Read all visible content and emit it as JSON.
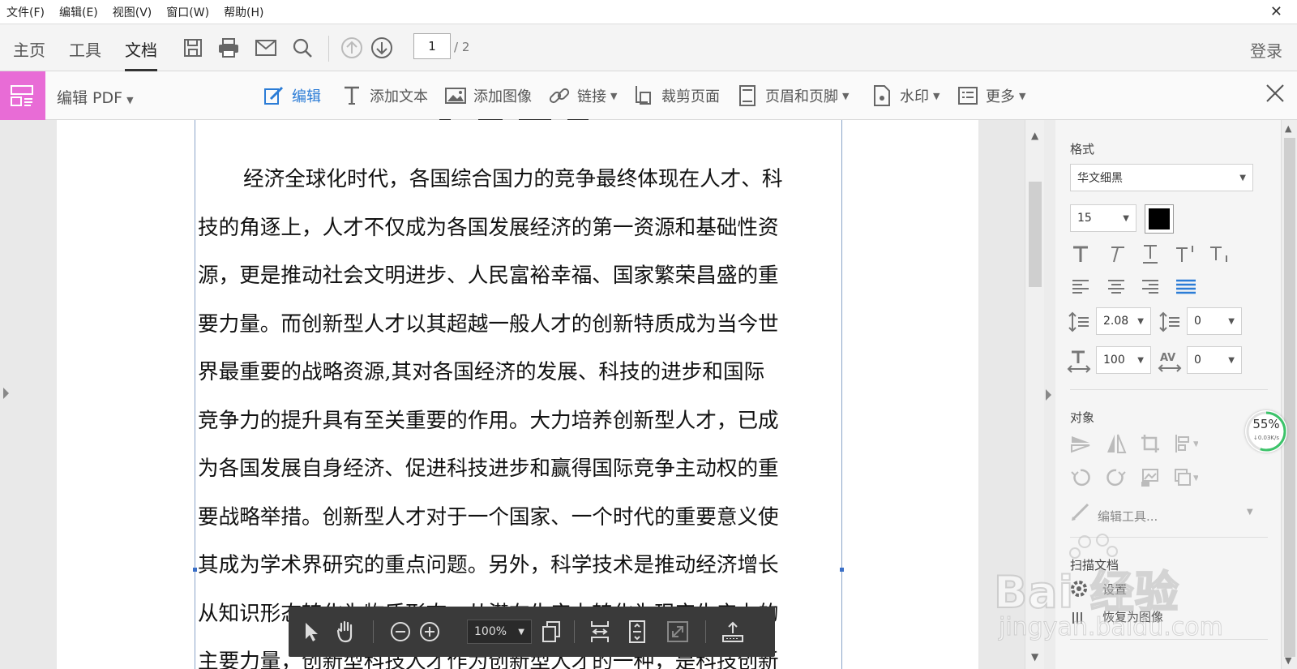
{
  "menu": [
    "文件(F)",
    "编辑(E)",
    "视图(V)",
    "窗口(W)",
    "帮助(H)"
  ],
  "window_close": "✕",
  "topbar": {
    "tabs": [
      "主页",
      "工具",
      "文档"
    ],
    "active_tab": "文档",
    "page_current": "1",
    "page_total": "/ 2",
    "login": "登录"
  },
  "editbar": {
    "title": "编辑 PDF",
    "tools": [
      {
        "label": "编辑",
        "icon": "edit-icon"
      },
      {
        "label": "添加文本",
        "icon": "add-text-icon"
      },
      {
        "label": "添加图像",
        "icon": "add-image-icon"
      },
      {
        "label": "链接",
        "icon": "link-icon"
      },
      {
        "label": "裁剪页面",
        "icon": "crop-page-icon"
      },
      {
        "label": "页眉和页脚",
        "icon": "header-footer-icon"
      },
      {
        "label": "水印",
        "icon": "watermark-icon"
      },
      {
        "label": "更多",
        "icon": "more-icon"
      }
    ],
    "accent": "#2b7cd6",
    "brand_color": "#e86cd6"
  },
  "document": {
    "lines": [
      "经济全球化时代，各国综合国力的竞争最终体现在人才、科",
      "技的角逐上，人才不仅成为各国发展经济的第一资源和基础性资",
      "源，更是推动社会文明进步、人民富裕幸福、国家繁荣昌盛的重",
      "要力量。而创新型人才以其超越一般人才的创新特质成为当今世",
      "界最重要的战略资源,其对各国经济的发展、科技的进步和国际",
      "竞争力的提升具有至关重要的作用。大力培养创新型人才，已成",
      "为各国发展自身经济、促进科技进步和赢得国际竞争主动权的重",
      "要战略举措。创新型人才对于一个国家、一个时代的重要意义使",
      "其成为学术界研究的重点问题。另外，科学技术是推动经济增长",
      "从知识形态转化为物质形态，从潜在生产力转化为现实生产力的",
      "主要力量，创新型科技人才作为创新型人才的一种，是科技创新"
    ]
  },
  "panel": {
    "format_title": "格式",
    "font": "华文细黑",
    "font_size": "15",
    "text_color": "#000000",
    "line_spacing": "2.08",
    "para_spacing": "0",
    "h_scale": "100",
    "char_spacing": "0",
    "object_title": "对象",
    "edit_tools": "编辑工具...",
    "scan_title": "扫描文档",
    "settings": "设置",
    "restore": "恢复为图像"
  },
  "floatbar": {
    "zoom": "100%"
  },
  "badge": {
    "percent": "55%",
    "speed": "↓0.03K/s"
  },
  "watermark": {
    "big": "Bai 经验",
    "small": "jingyan.baidu.com"
  }
}
